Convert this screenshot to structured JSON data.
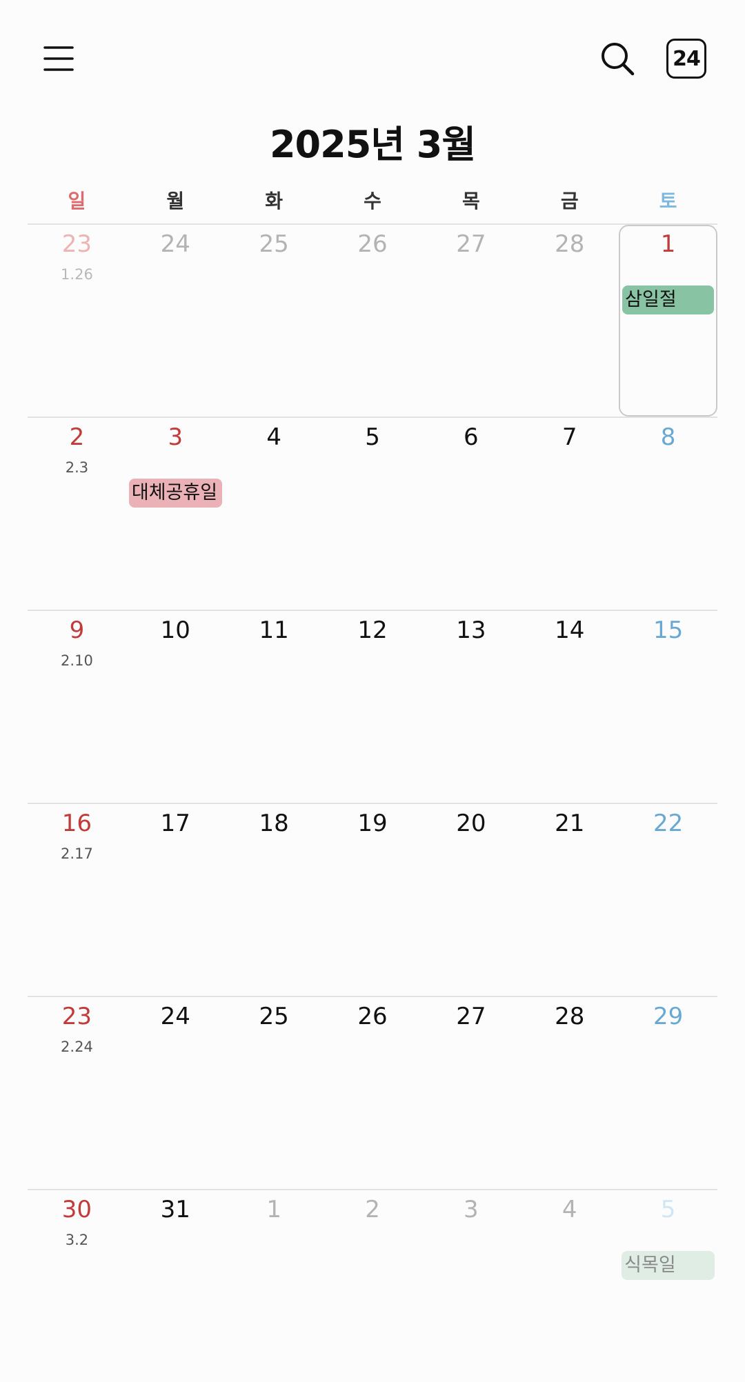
{
  "header": {
    "menu_icon": "hamburger-menu-icon",
    "search_icon": "search-icon",
    "today_label": "24",
    "title": "2025년 3월"
  },
  "weekdays": [
    "일",
    "월",
    "화",
    "수",
    "목",
    "금",
    "토"
  ],
  "weeks": [
    [
      {
        "day": "23",
        "lunar": "1.26",
        "other": true
      },
      {
        "day": "24",
        "other": true
      },
      {
        "day": "25",
        "other": true
      },
      {
        "day": "26",
        "other": true
      },
      {
        "day": "27",
        "other": true
      },
      {
        "day": "28",
        "other": true
      },
      {
        "day": "1",
        "holiday": true,
        "selected": true,
        "event": "삼일절",
        "event_color": "green"
      }
    ],
    [
      {
        "day": "2",
        "lunar": "2.3"
      },
      {
        "day": "3",
        "holiday": true,
        "event": "대체공휴일",
        "event_color": "pink"
      },
      {
        "day": "4"
      },
      {
        "day": "5"
      },
      {
        "day": "6"
      },
      {
        "day": "7"
      },
      {
        "day": "8"
      }
    ],
    [
      {
        "day": "9",
        "lunar": "2.10"
      },
      {
        "day": "10"
      },
      {
        "day": "11"
      },
      {
        "day": "12"
      },
      {
        "day": "13"
      },
      {
        "day": "14"
      },
      {
        "day": "15"
      }
    ],
    [
      {
        "day": "16",
        "lunar": "2.17"
      },
      {
        "day": "17"
      },
      {
        "day": "18"
      },
      {
        "day": "19"
      },
      {
        "day": "20"
      },
      {
        "day": "21"
      },
      {
        "day": "22"
      }
    ],
    [
      {
        "day": "23",
        "lunar": "2.24"
      },
      {
        "day": "24"
      },
      {
        "day": "25"
      },
      {
        "day": "26"
      },
      {
        "day": "27"
      },
      {
        "day": "28"
      },
      {
        "day": "29"
      }
    ],
    [
      {
        "day": "30",
        "lunar": "3.2"
      },
      {
        "day": "31"
      },
      {
        "day": "1",
        "other": true
      },
      {
        "day": "2",
        "other": true
      },
      {
        "day": "3",
        "other": true
      },
      {
        "day": "4",
        "other": true
      },
      {
        "day": "5",
        "other": true,
        "event": "식목일",
        "event_color": "fade"
      }
    ]
  ],
  "colors": {
    "sunday": "#c23a3a",
    "saturday": "#6aa8d4",
    "holiday_green": "#88c3a3",
    "holiday_pink": "#eab1b6"
  }
}
